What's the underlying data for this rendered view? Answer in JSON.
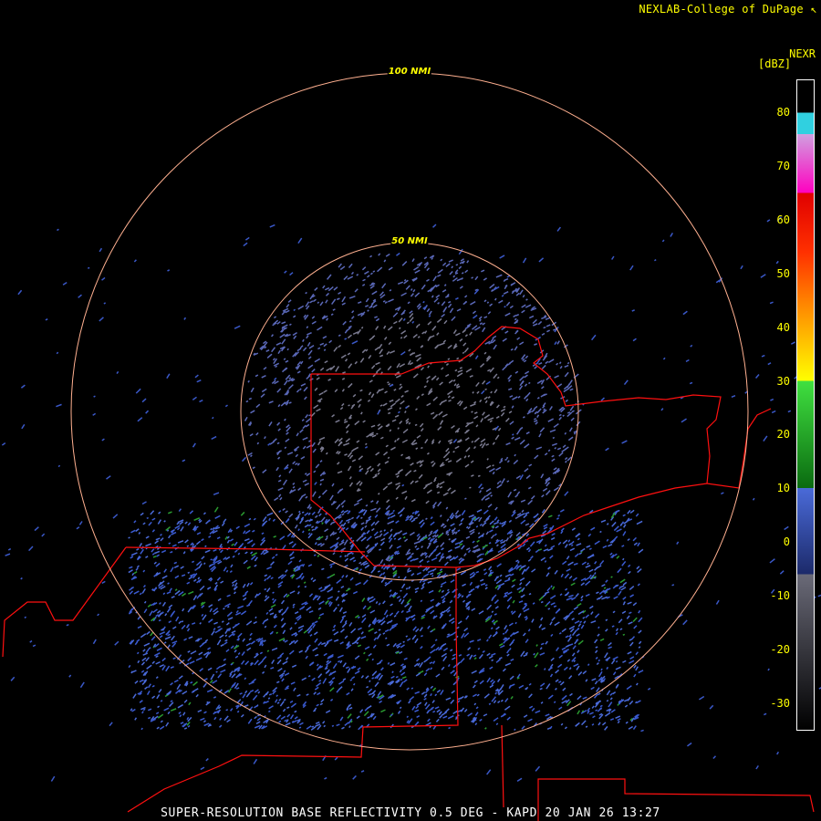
{
  "header": {
    "credit": "NEXLAB-College of DuPage ↖",
    "product": "NEXR",
    "unit": "[dBZ]"
  },
  "rings": [
    {
      "label": "50 NMI",
      "nmi": 50
    },
    {
      "label": "100 NMI",
      "nmi": 100
    }
  ],
  "colorbar": {
    "min": -35,
    "max": 86,
    "ticks": [
      "80",
      "70",
      "60",
      "50",
      "40",
      "30",
      "20",
      "10",
      "0",
      "-10",
      "-20",
      "-30"
    ],
    "tick_values": [
      80,
      70,
      60,
      50,
      40,
      30,
      20,
      10,
      0,
      -10,
      -20,
      -30
    ],
    "stops": [
      {
        "dbz": -35,
        "color": "#000000"
      },
      {
        "dbz": -6,
        "color": "#6a6a78"
      },
      {
        "dbz": -6,
        "color": "#1c2a6a"
      },
      {
        "dbz": 10,
        "color": "#4a6ad8"
      },
      {
        "dbz": 10,
        "color": "#0a6a10"
      },
      {
        "dbz": 30,
        "color": "#40e040"
      },
      {
        "dbz": 30,
        "color": "#ffff00"
      },
      {
        "dbz": 45,
        "color": "#ff8000"
      },
      {
        "dbz": 54,
        "color": "#ff3000"
      },
      {
        "dbz": 65,
        "color": "#e00000"
      },
      {
        "dbz": 65,
        "color": "#ff00c0"
      },
      {
        "dbz": 76,
        "color": "#d0a0e0"
      },
      {
        "dbz": 76,
        "color": "#30d0e0"
      },
      {
        "dbz": 80,
        "color": "#30d0e0"
      },
      {
        "dbz": 80,
        "color": "#000000"
      }
    ]
  },
  "caption": "SUPER-RESOLUTION BASE REFLECTIVITY 0.5 DEG - KAPD 20 JAN 26 13:27"
}
